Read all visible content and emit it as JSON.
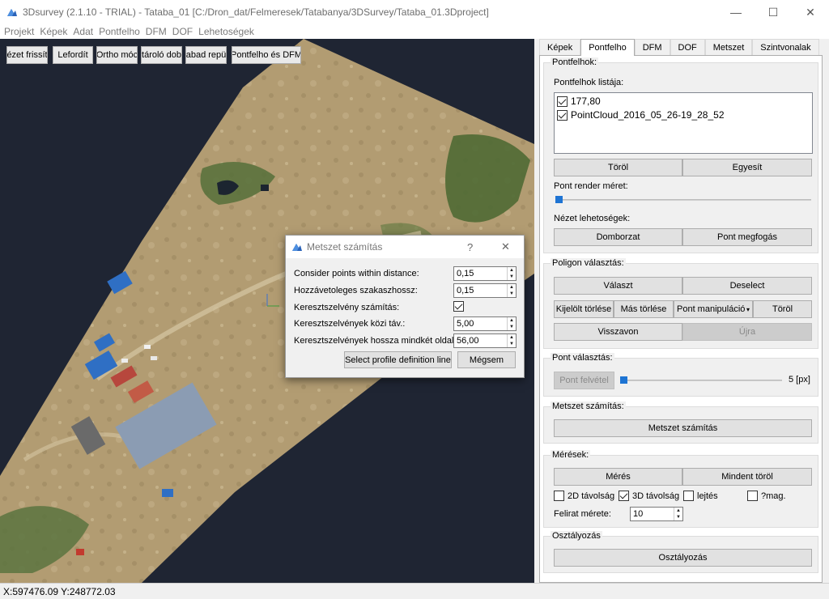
{
  "window": {
    "title": "3Dsurvey (2.1.10 - TRIAL) - Tataba_01 [C:/Dron_dat/Felmeresek/Tatabanya/3DSurvey/Tataba_01.3Dproject]",
    "minimize_glyph": "—",
    "maximize_glyph": "☐",
    "close_glyph": "✕"
  },
  "menu": [
    "Projekt",
    "Képek",
    "Adat",
    "Pontfelho",
    "DFM",
    "DOF",
    "Lehetoségek"
  ],
  "toolbar": {
    "refresh": "ézet frissít",
    "flip": "Lefordít",
    "ortho": "Ortho móc",
    "container": "tároló dob",
    "free_flight": "abad repü",
    "pointcloud_dfm": "Pontfelho és DFM"
  },
  "status": {
    "coords": "X:597476.09 Y:248772.03"
  },
  "tabs": [
    "Képek",
    "Pontfelho",
    "DFM",
    "DOF",
    "Metszet",
    "Szintvonalak"
  ],
  "active_tab_index": 1,
  "pointclouds": {
    "group_label": "Pontfelhok:",
    "list_label": "Pontfelhok listája:",
    "items": [
      {
        "label": "177,80",
        "checked": true
      },
      {
        "label": "PointCloud_2016_05_26-19_28_52",
        "checked": true
      }
    ],
    "delete": "Töröl",
    "merge": "Egyesít",
    "render_size_label": "Pont render méret:",
    "render_size_fraction": 0.0,
    "view_options_label": "Nézet lehetoségek:",
    "relief": "Domborzat",
    "point_snap": "Pont megfogás"
  },
  "polygon": {
    "group_label": "Poligon választás:",
    "select": "Választ",
    "deselect": "Deselect",
    "delete_selected": "Kijelölt törlése",
    "delete_other": "Más törlése",
    "manipulation": "Pont manipuláció",
    "manipulation_arrow": "▾",
    "delete": "Töröl",
    "undo": "Visszavon",
    "redo": "Újra"
  },
  "point_select": {
    "group_label": "Pont választás:",
    "pick": "Pont felvétel",
    "size_value": "5 [px]",
    "size_fraction": 0.0
  },
  "section": {
    "group_label": "Metszet számítás:",
    "compute": "Metszet számítás"
  },
  "measure": {
    "group_label": "Mérések:",
    "measure": "Mérés",
    "clear_all": "Mindent töröl",
    "options": [
      {
        "label": "2D távolság",
        "checked": false
      },
      {
        "label": "3D távolság",
        "checked": true
      },
      {
        "label": "lejtés",
        "checked": false
      },
      {
        "label": "?mag.",
        "checked": false
      }
    ],
    "font_size_label": "Felirat mérete:",
    "font_size_value": "10"
  },
  "classify": {
    "group_label": "Osztályozás",
    "button": "Osztályozás"
  },
  "dialog": {
    "title": "Metszet számítás",
    "help_glyph": "?",
    "close_glyph": "✕",
    "rows": [
      {
        "label": "Consider points within distance:",
        "value": "0,15"
      },
      {
        "label": "Hozzávetoleges szakaszhossz:",
        "value": "0,15"
      },
      {
        "label": "Keresztszelvény számítás:",
        "checked": true
      },
      {
        "label": "Keresztszelvények közi táv.:",
        "value": "5,00"
      },
      {
        "label": "Keresztszelvények hossza mindkét oldalon",
        "value": "56,00"
      }
    ],
    "select_line": "Select profile definition line",
    "cancel": "Mégsem"
  },
  "colors": {
    "accent": "#1e74d3",
    "viewport_bg": "#1f2533",
    "terrain": "#b29c72",
    "vegetation": "#4f6a34",
    "roof_blue": "#2f6fc4"
  }
}
